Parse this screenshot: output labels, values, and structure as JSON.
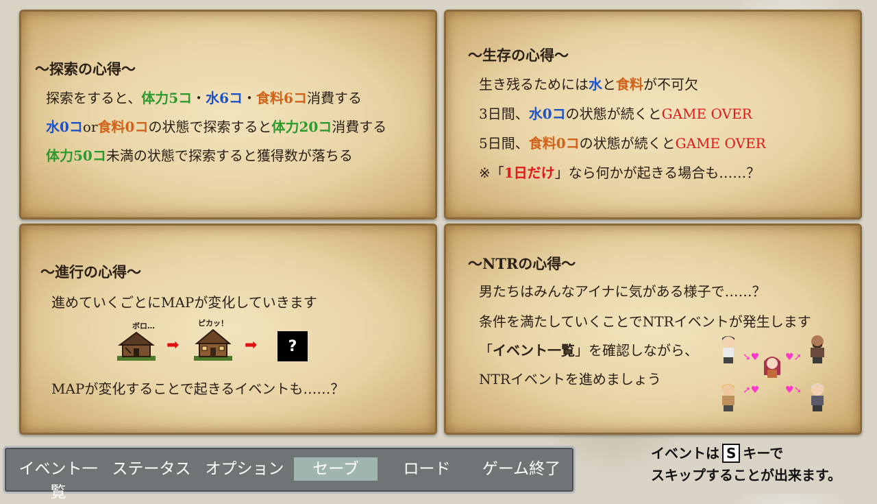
{
  "panels": {
    "explore": {
      "title": "〜探索の心得〜",
      "line1": [
        "探索をすると、",
        "体力5コ",
        "・",
        "水6コ",
        "・",
        "食料6コ",
        "消費する"
      ],
      "line2": [
        "水0コ",
        "or",
        "食料0コ",
        "の状態で探索すると",
        "体力20コ",
        "消費する"
      ],
      "line3": [
        "体力50コ",
        "未満の状態で探索すると獲得数が落ちる"
      ]
    },
    "survival": {
      "title": "〜生存の心得〜",
      "line1": [
        "生き残るためには",
        "水",
        "と",
        "食料",
        "が不可欠"
      ],
      "line2": [
        "3日間、",
        "水0コ",
        "の状態が続くと",
        "GAME OVER"
      ],
      "line3": [
        "5日間、",
        "食料0コ",
        "の状態が続くと",
        "GAME OVER"
      ],
      "line4": [
        "※「",
        "1日だけ",
        "」なら何かが起きる場合も……？"
      ]
    },
    "progress": {
      "title": "〜進行の心得〜",
      "line1": "進めていくごとにMAPが変化していきます",
      "label_old": "ボロ…",
      "label_new": "ピカッ！",
      "mystery": "?",
      "line2": "MAPが変化することで起きるイベントも……？"
    },
    "ntr": {
      "title": "〜NTRの心得〜",
      "line1": "男たちはみんなアイナに気がある様子で……？",
      "line2": "条件を満たしていくことでNTRイベントが発生します",
      "line3": [
        "「",
        "イベント一覧",
        "」を確認しながら、"
      ],
      "line4": "NTRイベントを進めましょう"
    }
  },
  "menu": {
    "items": [
      "イベント一覧",
      "ステータス",
      "オプション",
      "セーブ",
      "ロード",
      "ゲーム終了"
    ],
    "selected": "セーブ"
  },
  "hint": {
    "pre": "イベントは",
    "key": "S",
    "post": "キーで",
    "line2": "スキップすることが出来ます。"
  },
  "colors": {
    "stamina": "#2c9a2c",
    "water": "#1e52c8",
    "food": "#d0621a",
    "danger": "#e01818",
    "heart": "#ff38c8"
  }
}
